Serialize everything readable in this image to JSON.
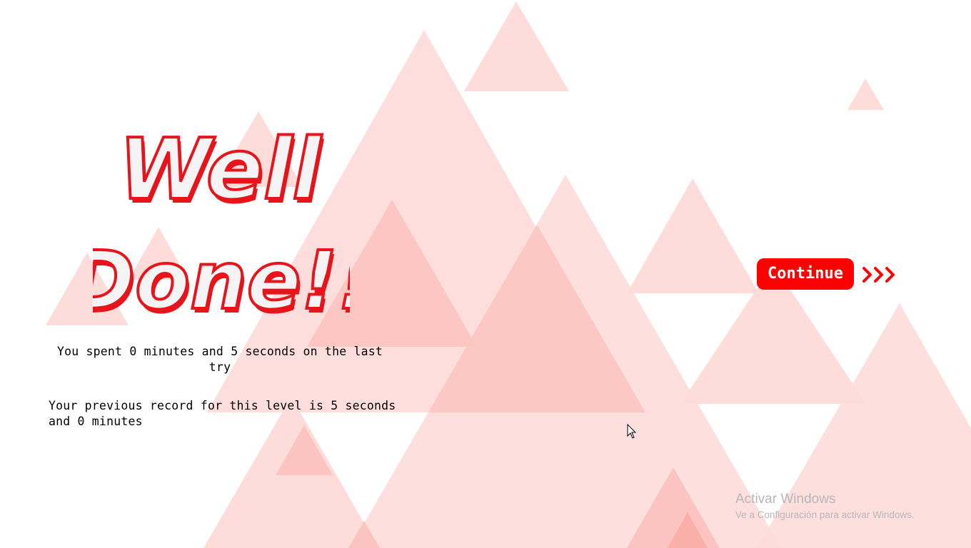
{
  "title": {
    "line1": "Well",
    "line2": "Done!!"
  },
  "messages": {
    "last_try": "You spent 0 minutes and 5 seconds on the last try",
    "record": "Your previous record for this level is 5 seconds and 0 minutes"
  },
  "continue_button": {
    "label": "Continue",
    "icon": "triple-chevron-right-icon"
  },
  "watermark": {
    "title": "Activar Windows",
    "subtitle": "Ve a Configuración para activar Windows."
  },
  "colors": {
    "accent": "#ff0000",
    "title_outline": "#e8141b",
    "triangle_light": "#fddcda",
    "triangle_mid": "#fcc4c0",
    "triangle_dark": "#fbafa9"
  }
}
